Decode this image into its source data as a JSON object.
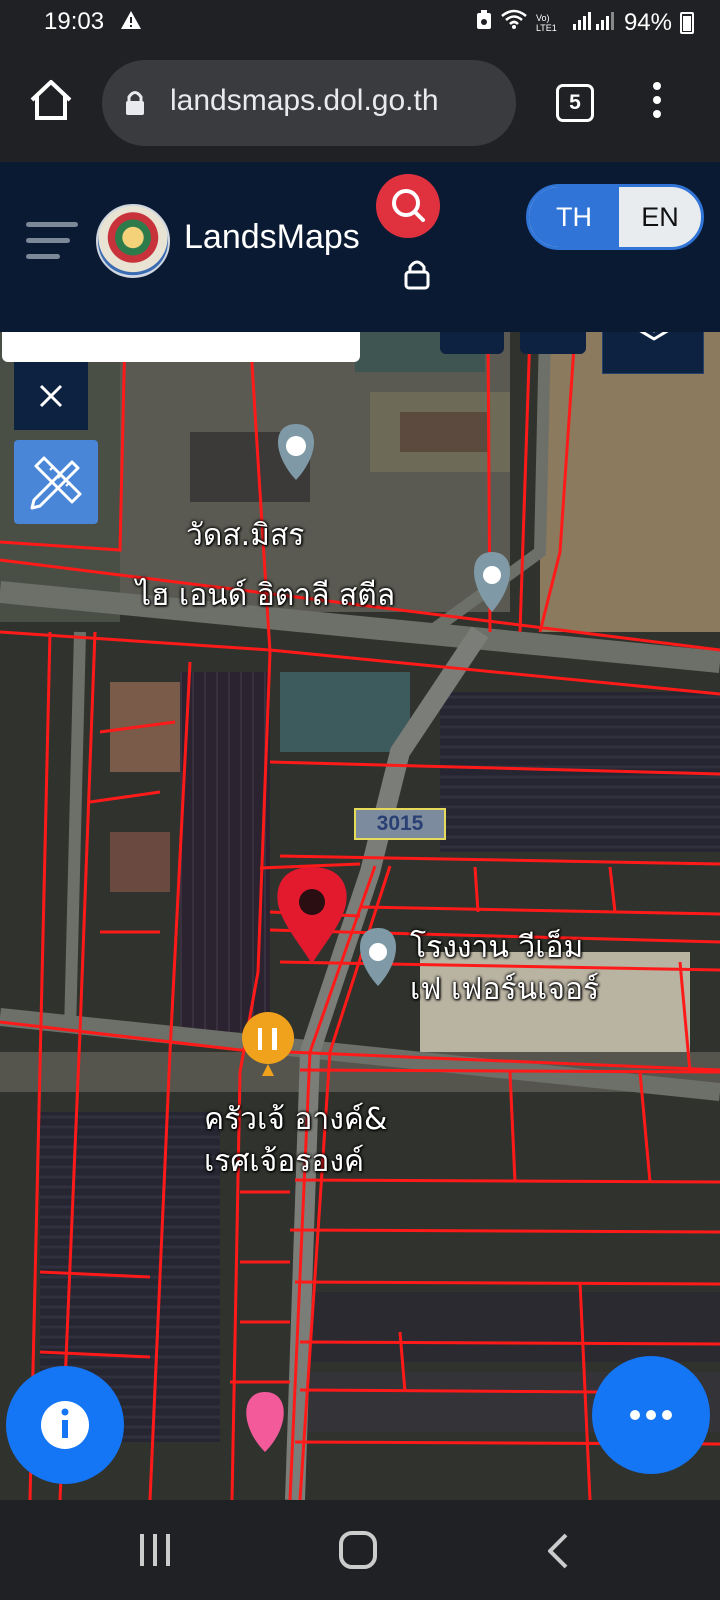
{
  "status_bar": {
    "time": "19:03",
    "battery": "94%",
    "network": "Vo) LTE1"
  },
  "browser": {
    "url": "landsmaps.dol.go.th",
    "tab_count": "5"
  },
  "app": {
    "brand": "LandsMaps",
    "lang_th": "TH",
    "lang_en": "EN"
  },
  "map": {
    "route_number": "3015",
    "labels": {
      "temple": "วัดส.มิสร",
      "steel": "ไฮ เอนด์ อิตาลี สตีล",
      "factory_line1": "โรงงาน วีเอ็ม",
      "factory_line2": "เฟ เฟอร์นเจอร์",
      "kitchen_line1": "ครัวเจ้ อางค์&",
      "kitchen_line2": "เรศเจ้อรองค์"
    }
  },
  "colors": {
    "parcel_line": "#ff1a1a",
    "header_bg": "#0b1a33",
    "accent_blue": "#1475f5",
    "search_red": "#e0313f"
  },
  "icons": {
    "home": "home-icon",
    "lock": "lock-icon",
    "menu": "more-vert-icon",
    "hamburger": "hamburger-icon",
    "search": "search-icon",
    "layers": "layers-icon",
    "close": "close-icon",
    "measure": "pencil-ruler-icon",
    "info": "info-icon",
    "more": "more-horiz-icon",
    "pin": "map-pin-icon"
  }
}
